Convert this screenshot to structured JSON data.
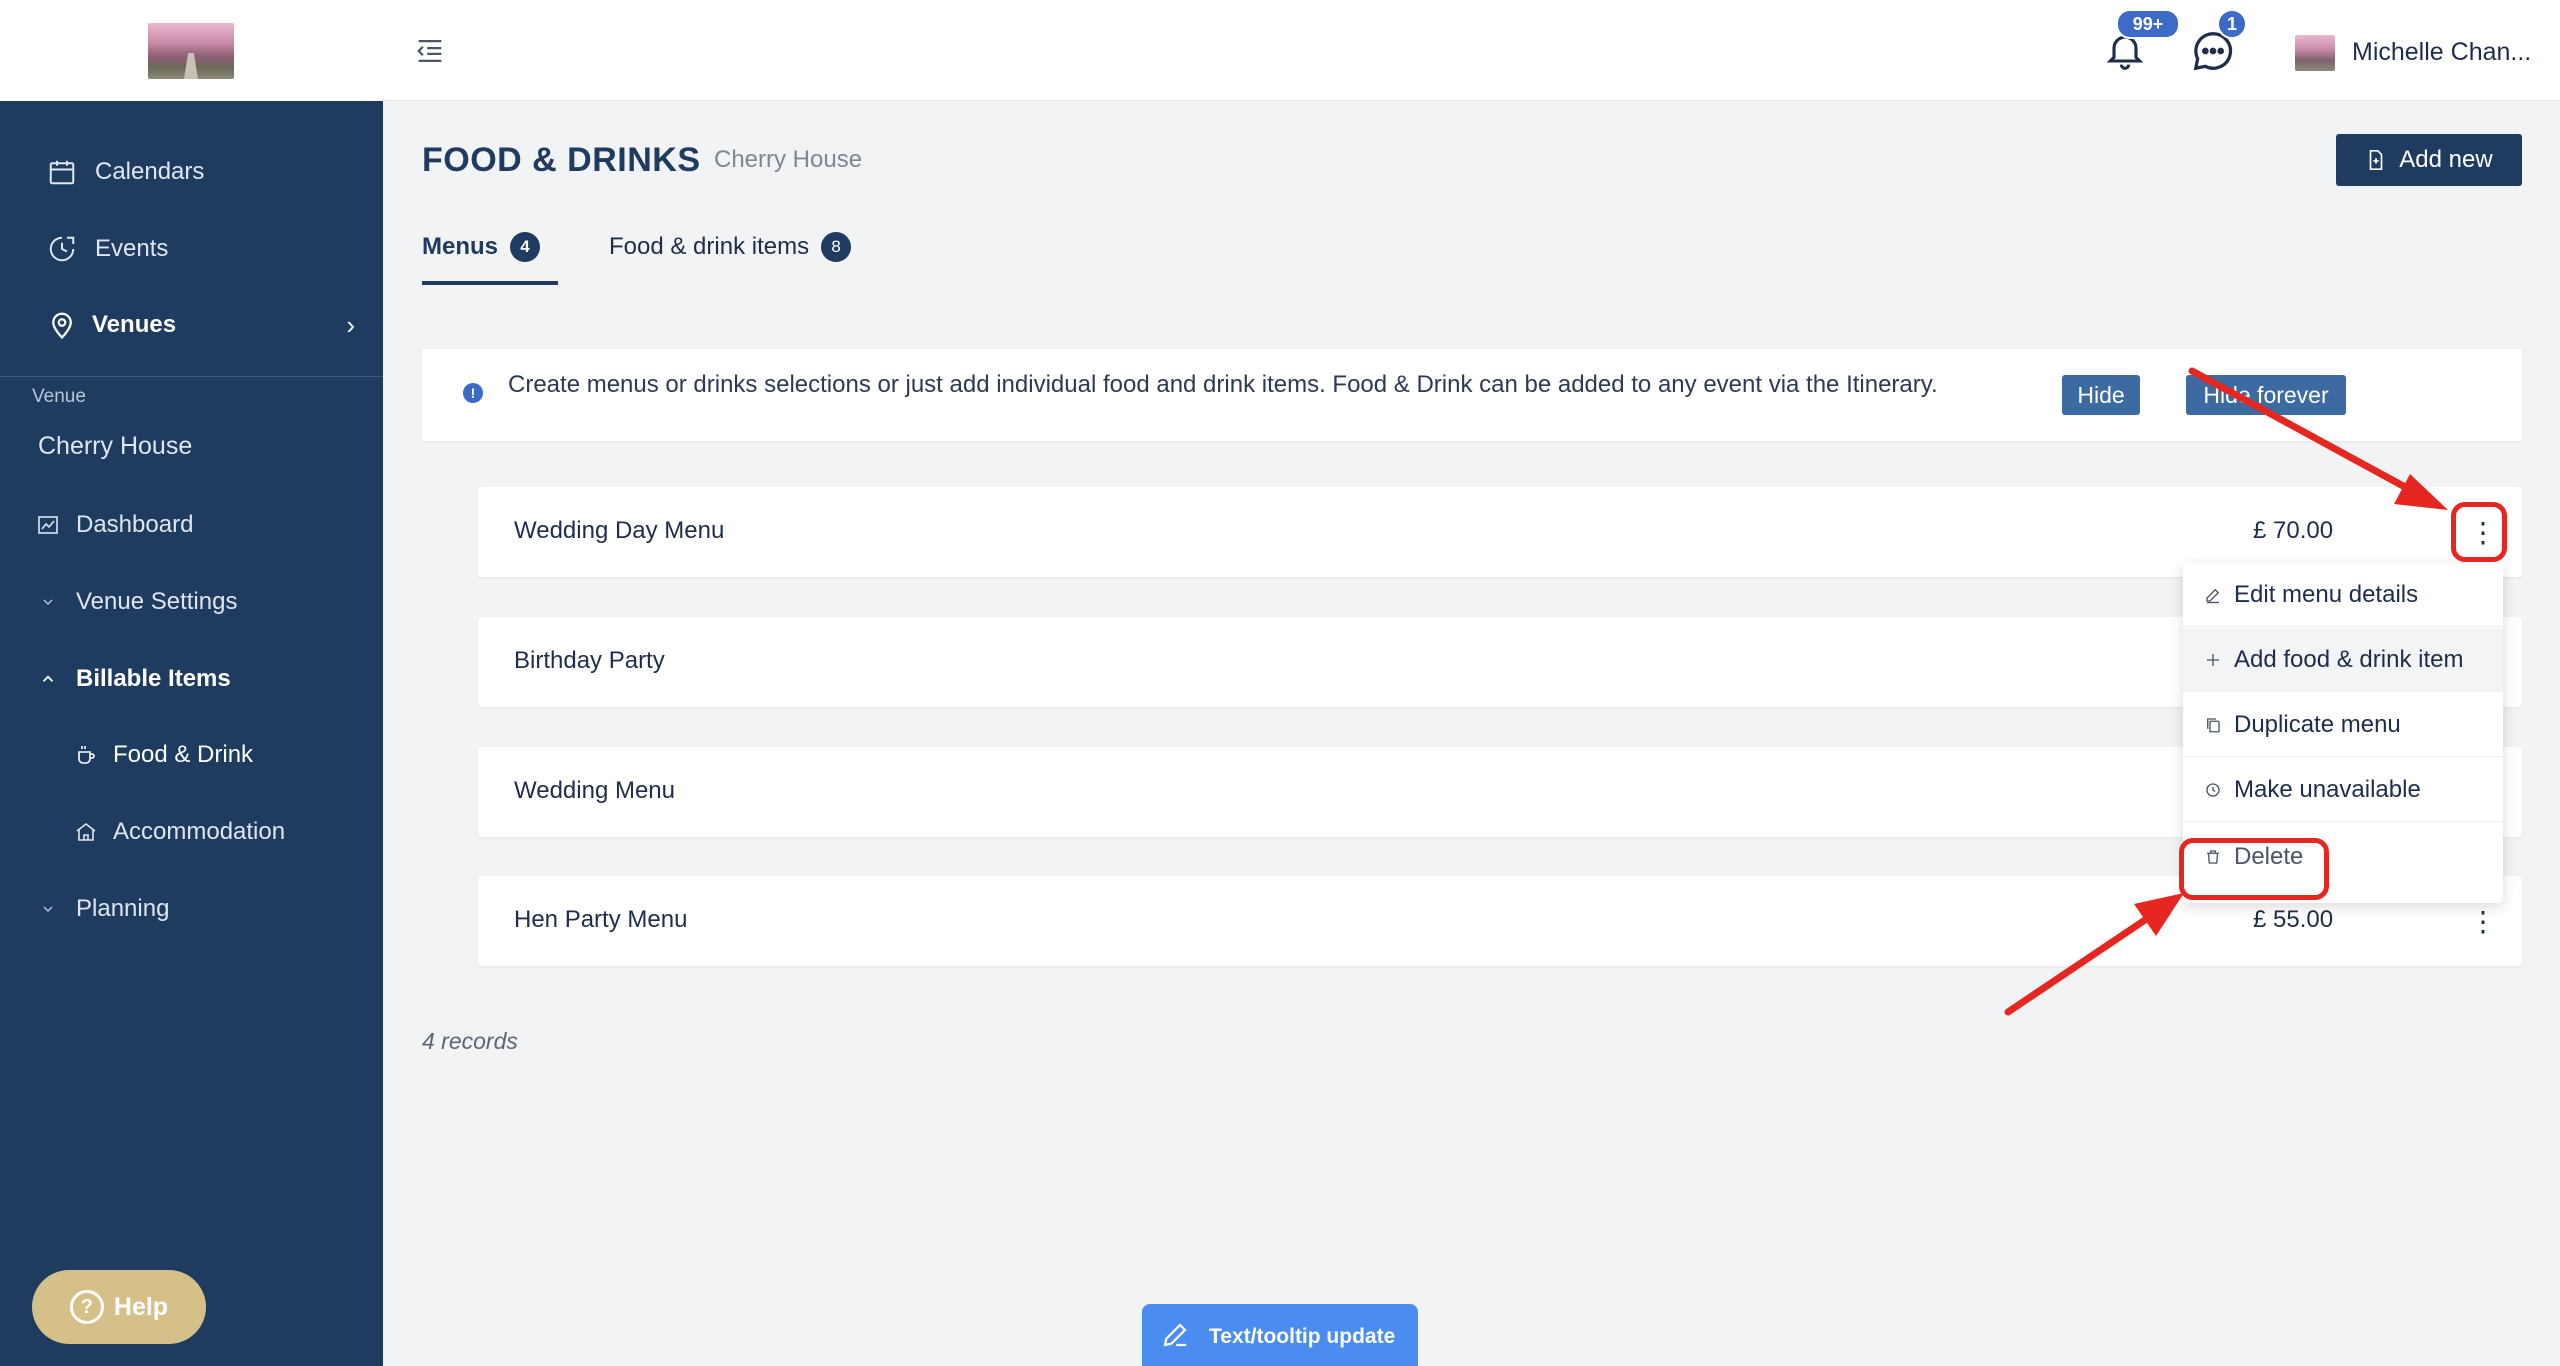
{
  "sidebar": {
    "nav": [
      {
        "label": "Calendars",
        "icon": "calendar-icon"
      },
      {
        "label": "Events",
        "icon": "events-icon"
      },
      {
        "label": "Venues",
        "icon": "location-pin-icon"
      }
    ],
    "venue_caption": "Venue",
    "venue_name": "Cherry House",
    "sub": [
      {
        "label": "Dashboard",
        "icon": "chart-icon"
      },
      {
        "label": "Venue Settings",
        "icon": "chevron-down-icon"
      },
      {
        "label": "Billable Items",
        "icon": "chevron-up-icon"
      },
      {
        "label": "Food & Drink",
        "icon": "coffee-cup-icon"
      },
      {
        "label": "Accommodation",
        "icon": "home-icon"
      },
      {
        "label": "Planning",
        "icon": "chevron-down-icon"
      }
    ],
    "help_label": "Help"
  },
  "topbar": {
    "notifications_badge": "99+",
    "messages_badge": "1",
    "user_name": "Michelle Chan..."
  },
  "page": {
    "title": "FOOD & DRINKS",
    "subtitle": "Cherry House",
    "add_new_label": "Add new"
  },
  "tabs": [
    {
      "label": "Menus",
      "count": "4",
      "active": true
    },
    {
      "label": "Food & drink items",
      "count": "8",
      "active": false
    }
  ],
  "info_banner": {
    "icon_glyph": "!",
    "text": "Create menus or drinks selections or just add individual food and drink items. Food & Drink can be added to any event via the Itinerary.",
    "hide_label": "Hide",
    "hide_forever_label": "Hide forever"
  },
  "menus": [
    {
      "name": "Wedding Day Menu",
      "price": "£ 70.00"
    },
    {
      "name": "Birthday Party",
      "price": ""
    },
    {
      "name": "Wedding Menu",
      "price": ""
    },
    {
      "name": "Hen Party Menu",
      "price": "£ 55.00"
    }
  ],
  "records_text": "4 records",
  "dropdown": {
    "items": [
      {
        "label": "Edit menu details",
        "icon": "pencil-icon"
      },
      {
        "label": "Add food & drink item",
        "icon": "plus-icon"
      },
      {
        "label": "Duplicate menu",
        "icon": "copy-icon"
      },
      {
        "label": "Make unavailable",
        "icon": "clock-icon"
      },
      {
        "label": "Delete",
        "icon": "trash-icon"
      }
    ]
  },
  "toast": {
    "label": "Text/tooltip update"
  },
  "colors": {
    "sidebar_bg": "#1f3b60",
    "primary": "#1f3b60",
    "badge_blue": "#3b6bc4",
    "help_gold": "#d6c08a",
    "annotation_red": "#e62620",
    "toast_blue": "#4a8cf0"
  }
}
